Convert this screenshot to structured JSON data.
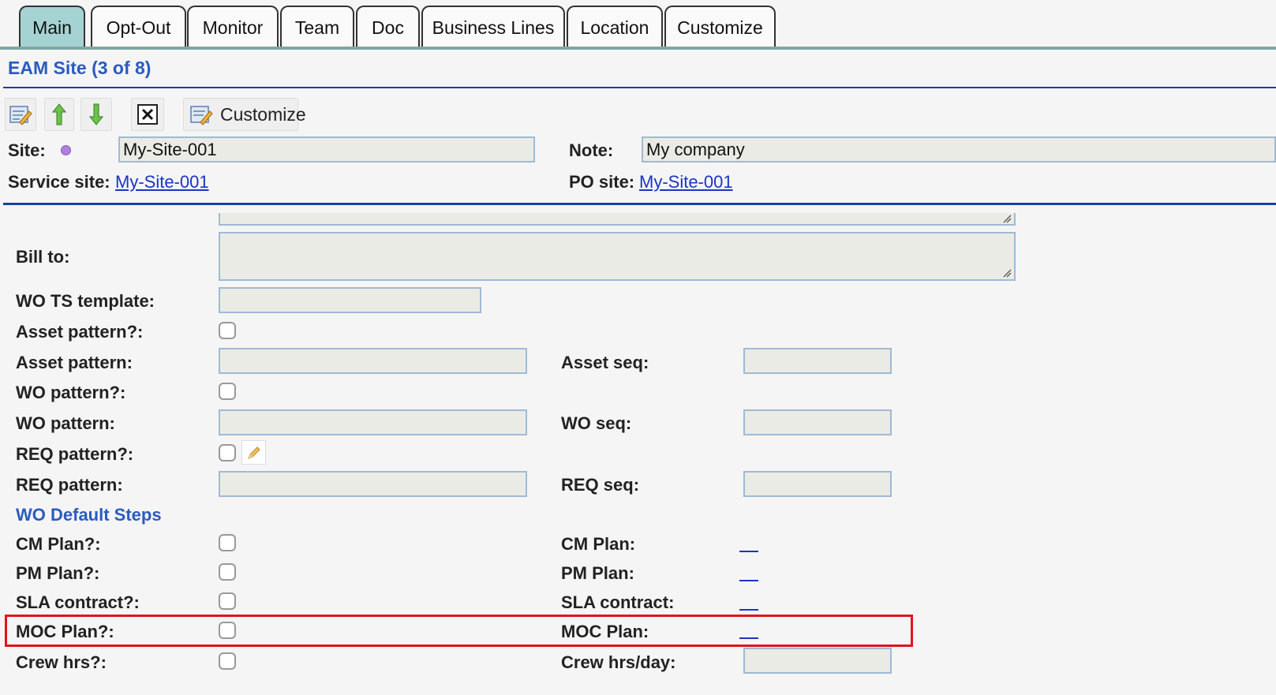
{
  "tabs": [
    "Main",
    "Opt-Out",
    "Monitor",
    "Team",
    "Doc",
    "Business Lines",
    "Location",
    "Customize"
  ],
  "title": "EAM Site (3 of 8)",
  "toolbar": {
    "edit_icon": "edit-record-icon",
    "up_icon": "arrow-up-icon",
    "down_icon": "arrow-down-icon",
    "close_icon": "close-icon",
    "customize_label": "Customize"
  },
  "header_form": {
    "site_label": "Site:",
    "site_value": "My-Site-001",
    "note_label": "Note:",
    "note_value": "My company",
    "service_site_label": "Service site:",
    "service_site_value": "My-Site-001",
    "po_site_label": "PO site:",
    "po_site_value": "My-Site-001"
  },
  "form": {
    "bill_to_label": "Bill to:",
    "bill_to_value": "",
    "wo_ts_template_label": "WO TS template:",
    "wo_ts_template_value": "",
    "asset_pattern_q_label": "Asset pattern?:",
    "asset_pattern_label": "Asset pattern:",
    "asset_seq_label": "Asset seq:",
    "wo_pattern_q_label": "WO pattern?:",
    "wo_pattern_label": "WO pattern:",
    "wo_seq_label": "WO seq:",
    "req_pattern_q_label": "REQ pattern?:",
    "req_pattern_label": "REQ pattern:",
    "req_seq_label": "REQ seq:",
    "section_wo_default_steps": "WO Default Steps",
    "cm_plan_q_label": "CM Plan?:",
    "cm_plan_label": "CM Plan:",
    "pm_plan_q_label": "PM Plan?:",
    "pm_plan_label": "PM Plan:",
    "sla_contract_q_label": "SLA contract?:",
    "sla_contract_label": "SLA contract:",
    "moc_plan_q_label": "MOC Plan?:",
    "moc_plan_label": "MOC Plan:",
    "crew_hrs_q_label": "Crew hrs?:",
    "crew_hrs_day_label": "Crew hrs/day:"
  },
  "colors": {
    "active_tab": "#a5d3d3",
    "title_blue": "#2a5bbf",
    "link_blue": "#1b34c8",
    "highlight_red": "#e0141e"
  }
}
